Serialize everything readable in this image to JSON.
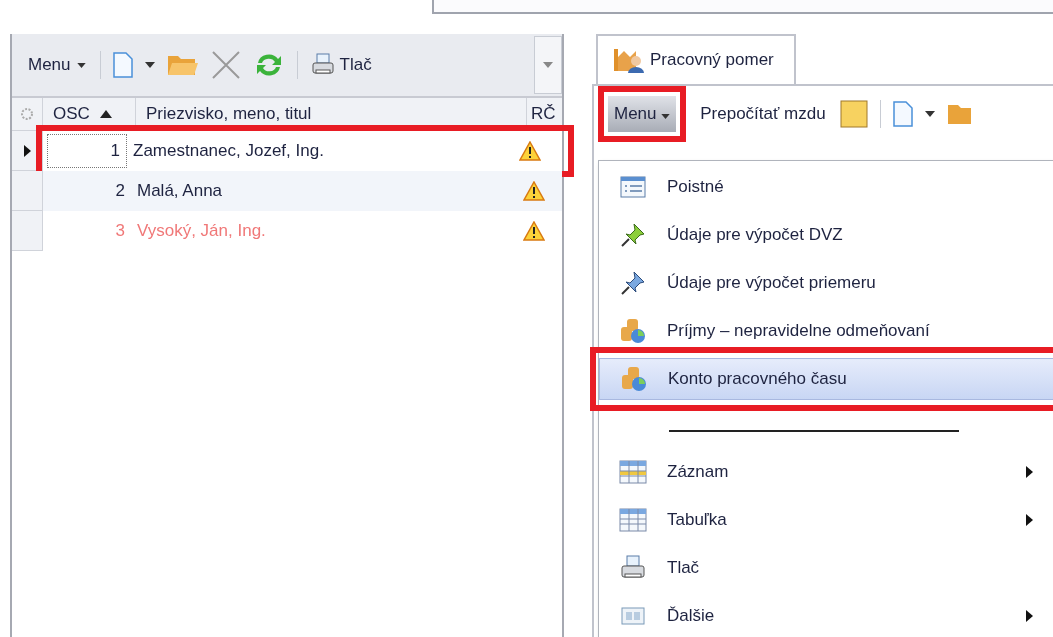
{
  "left_toolbar": {
    "menu_label": "Menu",
    "print_label": "Tlač"
  },
  "table": {
    "columns": [
      {
        "label": "OSC",
        "sorted": true
      },
      {
        "label": "Priezvisko, meno, titul",
        "sorted": false
      },
      {
        "label": "RČ",
        "sorted": false
      }
    ],
    "rows": [
      {
        "osc": "1",
        "name": "Zamestnanec, Jozef, Ing.",
        "selected": true,
        "highlighted": true,
        "color": "#1e2340",
        "warning": true
      },
      {
        "osc": "2",
        "name": "Malá, Anna",
        "selected": false,
        "highlighted": false,
        "color": "#1e2340",
        "warning": true
      },
      {
        "osc": "3",
        "name": "Vysoký, Ján, Ing.",
        "selected": false,
        "highlighted": false,
        "color": "#f07878",
        "warning": true
      }
    ]
  },
  "tab": {
    "label": "Pracovný pomer",
    "selected": true
  },
  "right_toolbar": {
    "menu_label": "Menu",
    "menu_highlighted": true,
    "recalc_label": "Prepočítať mzdu"
  },
  "menu_items": [
    {
      "kind": "item",
      "label": "Poistné",
      "submenu": false,
      "selected": false
    },
    {
      "kind": "item",
      "label": "Údaje pre výpočet DVZ",
      "submenu": false,
      "selected": false
    },
    {
      "kind": "item",
      "label": "Údaje pre výpočet priemeru",
      "submenu": false,
      "selected": false
    },
    {
      "kind": "item",
      "label": "Príjmy – nepravidelne odmeňovaní",
      "submenu": false,
      "selected": false
    },
    {
      "kind": "item",
      "label": "Konto pracovného času",
      "submenu": false,
      "selected": true
    },
    {
      "kind": "separator"
    },
    {
      "kind": "item",
      "label": "Záznam",
      "submenu": true,
      "selected": false
    },
    {
      "kind": "item",
      "label": "Tabuľka",
      "submenu": true,
      "selected": false
    },
    {
      "kind": "item",
      "label": "Tlač",
      "submenu": false,
      "selected": false
    },
    {
      "kind": "item",
      "label": "Ďalšie",
      "submenu": true,
      "selected": false
    }
  ]
}
